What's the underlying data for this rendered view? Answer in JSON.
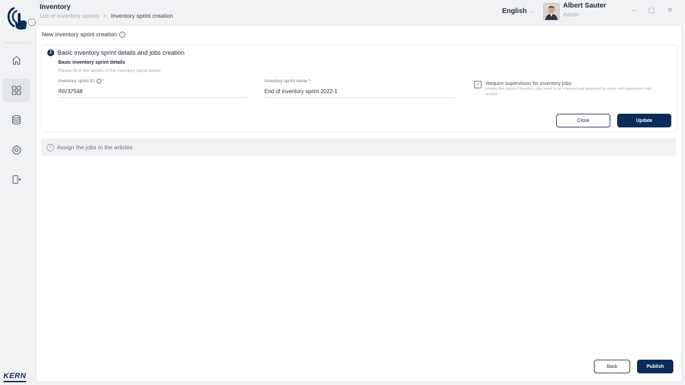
{
  "header": {
    "app_title": "Inventory",
    "breadcrumbs": [
      "List of inventory sprints",
      "Inventory sprint creation"
    ],
    "breadcrumb_separator": ">",
    "language": "English",
    "user": {
      "name": "Albert Sauter",
      "role": "Admin"
    },
    "window_controls": [
      "–",
      "▢",
      "✕"
    ]
  },
  "sidebar": {
    "items": [
      {
        "id": "home",
        "icon": "home-icon",
        "active": false
      },
      {
        "id": "dashboard",
        "icon": "grid-icon",
        "active": true
      },
      {
        "id": "database",
        "icon": "database-icon",
        "active": false
      },
      {
        "id": "settings",
        "icon": "gear-icon",
        "active": false
      },
      {
        "id": "logout",
        "icon": "logout-icon",
        "active": false
      }
    ],
    "brand": "KERN",
    "collapse_glyph": "›"
  },
  "page": {
    "title": "New inventory sprint creation",
    "info_glyph": "i",
    "step1": {
      "number": "1",
      "title": "Basic inventory sprint details and jobs creation",
      "subtitle": "Basic inventory sprint details",
      "hint": "Please fill in the details of the inventory sprint below.",
      "fields": {
        "sprint_id": {
          "label": "Inventory sprint ID",
          "value": "INV37548"
        },
        "sprint_name": {
          "label": "Inventory sprint name",
          "value": "End of inventory sprint 2022-1"
        }
      },
      "required_marker": "*",
      "supervision": {
        "checked": true,
        "label": "Require supervision for inventory jobs",
        "description": "Enable this option if inventory jobs need to be checked and approved by users with supervision role access."
      },
      "close_label": "Close",
      "update_label": "Update"
    },
    "step2": {
      "number": "2",
      "title": "Assign the jobs to the articles"
    },
    "back_label": "Back",
    "publish_label": "Publish"
  },
  "colors": {
    "primary": "#0c2b5a",
    "background": "#f1f2f4",
    "panel": "#ffffff"
  }
}
